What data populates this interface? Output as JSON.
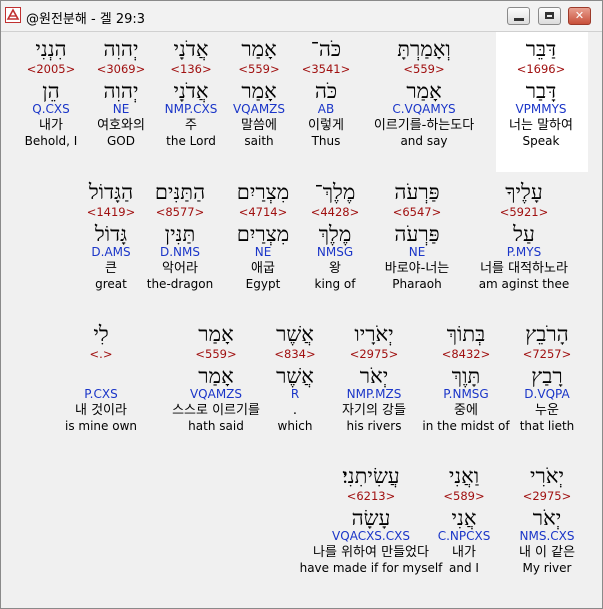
{
  "window": {
    "title": "@원전분해 - 겔 29:3",
    "buttons": {
      "minimize": "",
      "maximize": "",
      "close": "✕"
    }
  },
  "rows": [
    [
      {
        "heb": "דַּבֵּר",
        "strong": "<1696>",
        "lex": "דָּבַר",
        "parse": "VPMMYS",
        "ko": "너는 말하여",
        "en": "Speak"
      },
      {
        "heb": "וְאָמַרְתָּ",
        "strong": "<559>",
        "lex": "אָמַר",
        "parse": "C.VQAMYS",
        "ko": "이르기를-하는도다",
        "en": "and say"
      },
      {
        "heb": "כֹּה־",
        "strong": "<3541>",
        "lex": "כֹּה",
        "parse": "AB",
        "ko": "이렇게",
        "en": "Thus"
      },
      {
        "heb": "אָמַר",
        "strong": "<559>",
        "lex": "אָמַר",
        "parse": "VQAMZS",
        "ko": "말씀에",
        "en": "saith"
      },
      {
        "heb": "אֲדֹנָי",
        "strong": "<136>",
        "lex": "אֲדֹנָי",
        "parse": "NMP.CXS",
        "ko": "주",
        "en": "the Lord"
      },
      {
        "heb": "יְהוִה",
        "strong": "<3069>",
        "lex": "יְהוִה",
        "parse": "NE",
        "ko": "여호와의",
        "en": "GOD"
      },
      {
        "heb": "הִנְנִי",
        "strong": "<2005>",
        "lex": "הֵן",
        "parse": "Q.CXS",
        "ko": "내가",
        "en": "Behold, I"
      }
    ],
    [
      {
        "heb": "עָלֶיךָ",
        "strong": "<5921>",
        "lex": "עַל",
        "parse": "P.MYS",
        "ko": "너를 대적하노라",
        "en": "am aginst thee"
      },
      {
        "heb": "פַּרְעֹה",
        "strong": "<6547>",
        "lex": "פַּרְעֹה",
        "parse": "NE",
        "ko": "바로야-너는",
        "en": "Pharaoh"
      },
      {
        "heb": "מֶלֶךְ־",
        "strong": "<4428>",
        "lex": "מֶלֶךְ",
        "parse": "NMSG",
        "ko": "왕",
        "en": "king of"
      },
      {
        "heb": "מִצְרַיִם",
        "strong": "<4714>",
        "lex": "מִצְרַיִם",
        "parse": "NE",
        "ko": "애굽",
        "en": "Egypt"
      },
      {
        "heb": "הַתַּנִּים",
        "strong": "<8577>",
        "lex": "תַּנִּין",
        "parse": "D.NMS",
        "ko": "악어라",
        "en": "the-dragon"
      },
      {
        "heb": "הַגָּדוֹל",
        "strong": "<1419>",
        "lex": "גָּדוֹל",
        "parse": "D.AMS",
        "ko": "큰",
        "en": "great"
      }
    ],
    [
      {
        "heb": "הָרֹבֵץ",
        "strong": "<7257>",
        "lex": "רָבַץ",
        "parse": "D.VQPA",
        "ko": "누운",
        "en": "that lieth"
      },
      {
        "heb": "בְּתוֹךְ",
        "strong": "<8432>",
        "lex": "תָּוֶךְ",
        "parse": "P.NMSG",
        "ko": "중에",
        "en": "in the midst of"
      },
      {
        "heb": "יְאֹרָיו",
        "strong": "<2975>",
        "lex": "יְאֹר",
        "parse": "NMP.MZS",
        "ko": "자기의 강들",
        "en": "his rivers"
      },
      {
        "heb": "אֲשֶׁר",
        "strong": "<834>",
        "lex": "אֲשֶׁר",
        "parse": "R",
        "ko": ".",
        "en": "which"
      },
      {
        "heb": "אָמַר",
        "strong": "<559>",
        "lex": "אָמַר",
        "parse": "VQAMZS",
        "ko": "스스로 이르기를",
        "en": "hath said"
      },
      {
        "heb": "לִי",
        "strong": "<.>",
        "lex": "",
        "parse": "P.CXS",
        "ko": "내 것이라",
        "en": "is mine own"
      }
    ],
    [
      {
        "heb": "יְאֹרִי",
        "strong": "<2975>",
        "lex": "יְאֹר",
        "parse": "NMS.CXS",
        "ko": "내 이 같은",
        "en": "My river"
      },
      {
        "heb": "וַאֲנִי",
        "strong": "<589>",
        "lex": "אֲנִי",
        "parse": "C.NPCXS",
        "ko": "내가",
        "en": "and I"
      },
      {
        "heb": "עֲשִׂיתִנִי׃",
        "strong": "<6213>",
        "lex": "עָשָׂה",
        "parse": "VQACXS.CXS",
        "ko": "나를 위하여 만들었다",
        "en": "have made if for myself"
      }
    ]
  ]
}
